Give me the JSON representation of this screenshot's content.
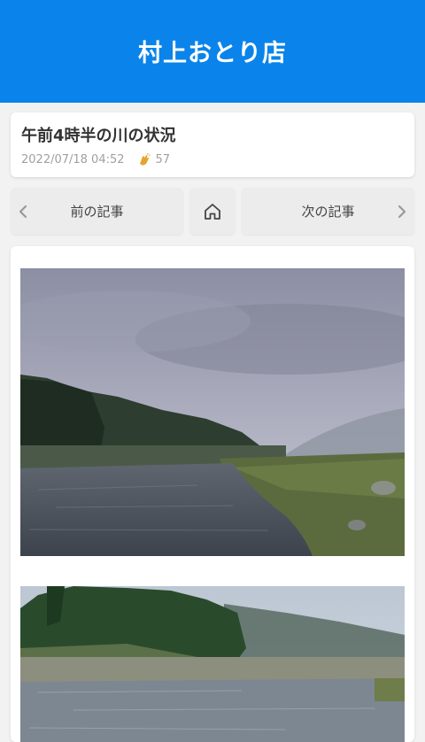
{
  "header": {
    "title": "村上おとり店"
  },
  "post": {
    "title": "午前4時半の川の状況",
    "datetime": "2022/07/18 04:52",
    "claps": "57"
  },
  "nav": {
    "prev_label": "前の記事",
    "next_label": "次の記事"
  },
  "icons": [
    "chevron-left-icon",
    "home-icon",
    "chevron-right-icon",
    "clap-icon"
  ],
  "colors": {
    "brand": "#0a84ea",
    "clap": "#e3a52a"
  }
}
